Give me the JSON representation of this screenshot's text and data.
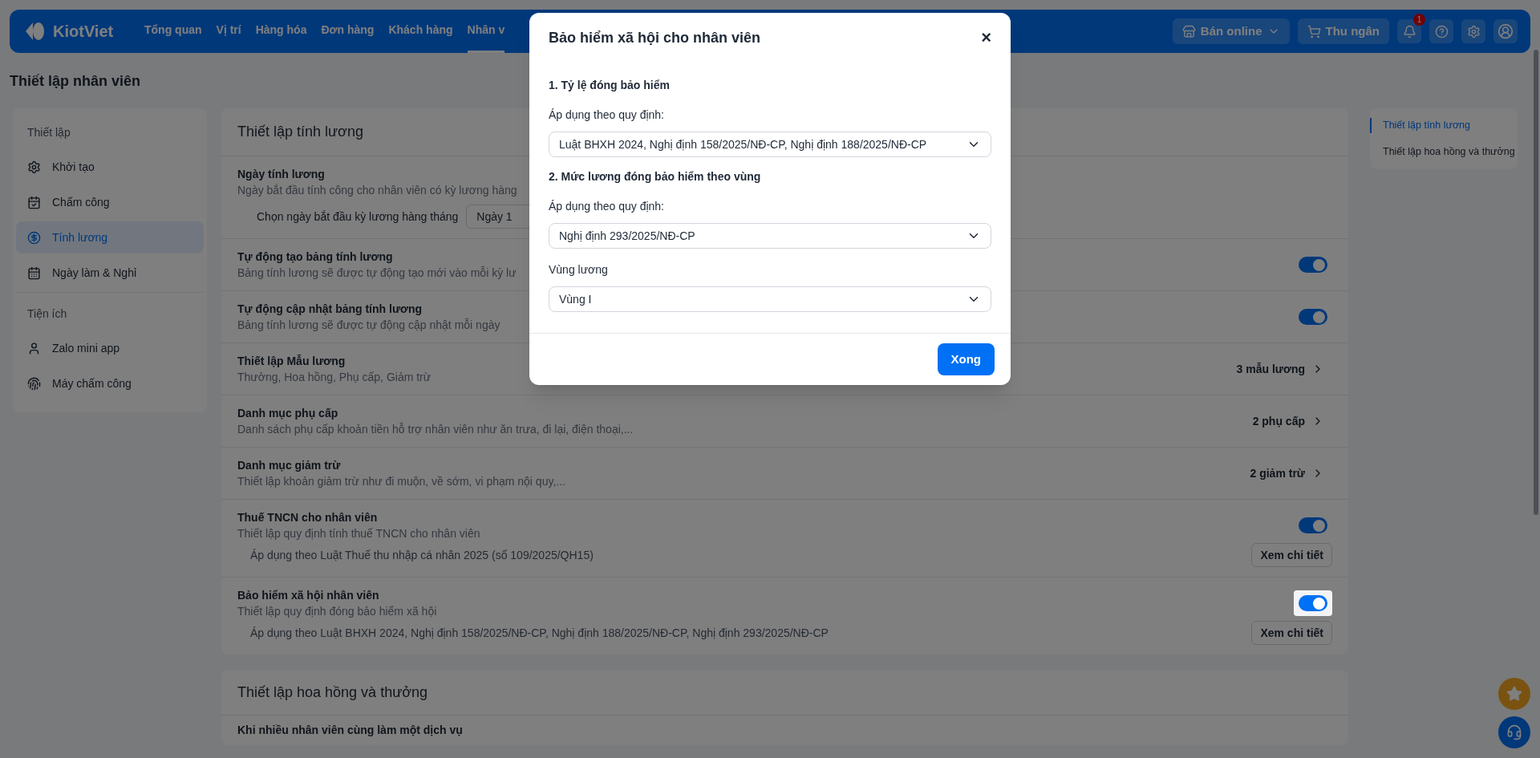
{
  "nav": {
    "logo": "KiotViet",
    "items": [
      {
        "label": "Tổng quan",
        "selected": false
      },
      {
        "label": "Vị trí",
        "selected": false
      },
      {
        "label": "Hàng hóa",
        "selected": false
      },
      {
        "label": "Đơn hàng",
        "selected": false
      },
      {
        "label": "Khách hàng",
        "selected": false
      },
      {
        "label": "Nhân v",
        "selected": true
      }
    ],
    "online_button": "Bán online",
    "cashier_button": "Thu ngân",
    "notification_count": "1"
  },
  "page_title": "Thiết lập nhân viên",
  "sidebar": {
    "sections": [
      {
        "title": "Thiết lập",
        "items": [
          {
            "label": "Khởi tạo",
            "selected": false
          },
          {
            "label": "Chấm công",
            "selected": false
          },
          {
            "label": "Tính lương",
            "selected": true
          },
          {
            "label": "Ngày làm & Nghỉ",
            "selected": false
          }
        ]
      },
      {
        "title": "Tiện ích",
        "items": [
          {
            "label": "Zalo mini app",
            "selected": false
          },
          {
            "label": "Máy chấm công",
            "selected": false
          }
        ]
      }
    ]
  },
  "payroll_card": {
    "title": "Thiết lập tính lương",
    "rows": [
      {
        "kind": "date",
        "title": "Ngày tính lương",
        "description": "Ngày bắt đầu tính công cho nhân viên có kỳ lương hàng",
        "field_label": "Chọn ngày bắt đầu kỳ lương hàng tháng",
        "field_value": "Ngày 1"
      },
      {
        "kind": "toggle",
        "title": "Tự động tạo bảng tính lương",
        "description": "Bảng tính lương sẽ được tự động tạo mới vào mỗi kỳ lư",
        "on": true,
        "focused": false
      },
      {
        "kind": "toggle",
        "title": "Tự động cập nhật bảng tính lương",
        "description": "Bảng tính lương sẽ được tự động cập nhật mỗi ngày",
        "on": true,
        "focused": false
      },
      {
        "kind": "link",
        "title": "Thiết lập Mẫu lương",
        "description": "Thưởng, Hoa hồng, Phụ cấp, Giảm trừ",
        "count": "3 mẫu lương"
      },
      {
        "kind": "link",
        "title": "Danh mục phụ cấp",
        "description": "Danh sách phụ cấp khoản tiền hỗ trợ nhân viên như ăn trưa, đi lại, điện thoại,...",
        "count": "2 phụ cấp"
      },
      {
        "kind": "link",
        "title": "Danh mục giảm trừ",
        "description": "Thiết lập khoản giảm trừ như đi muộn, về sớm, vi phạm nội quy,...",
        "count": "2 giảm trừ"
      },
      {
        "kind": "toggle_detail",
        "title": "Thuế TNCN cho nhân viên",
        "description": "Thiết lập quy định tính thuế TNCN cho nhân viên",
        "on": true,
        "focused": false,
        "note": "Áp dụng theo Luật Thuế thu nhập cá nhân 2025 (số 109/2025/QH15)",
        "button": "Xem chi tiết"
      },
      {
        "kind": "toggle_detail",
        "title": "Bảo hiểm xã hội nhân viên",
        "description": "Thiết lập quy định đóng bảo hiểm xã hội",
        "on": true,
        "focused": true,
        "note": "Áp dụng theo Luật BHXH 2024, Nghị định 158/2025/NĐ-CP, Nghị định 188/2025/NĐ-CP, Nghị định 293/2025/NĐ-CP",
        "button": "Xem chi tiết"
      }
    ]
  },
  "commission_card": {
    "title": "Thiết lập hoa hồng và thưởng",
    "rows": [
      {
        "title": "Khi nhiều nhân viên cùng làm một dịch vụ"
      }
    ]
  },
  "right_nav": {
    "items": [
      {
        "label": "Thiết lập tính lương",
        "selected": true
      },
      {
        "label": "Thiết lập hoa hồng và thưởng",
        "selected": false
      }
    ]
  },
  "modal": {
    "title": "Bảo hiểm xã hội cho nhân viên",
    "close": "×",
    "sections": [
      {
        "heading": "1. Tỷ lệ đóng bảo hiểm",
        "fields": [
          {
            "label": "Áp dụng theo quy định:",
            "value": "Luật BHXH 2024, Nghị định 158/2025/NĐ-CP, Nghị định 188/2025/NĐ-CP"
          }
        ]
      },
      {
        "heading": "2. Mức lương đóng bảo hiểm theo vùng",
        "fields": [
          {
            "label": "Áp dụng theo quy định:",
            "value": "Nghị định 293/2025/NĐ-CP"
          },
          {
            "label": "Vùng lương",
            "value": "Vùng I"
          }
        ]
      }
    ],
    "done_button": "Xong"
  }
}
